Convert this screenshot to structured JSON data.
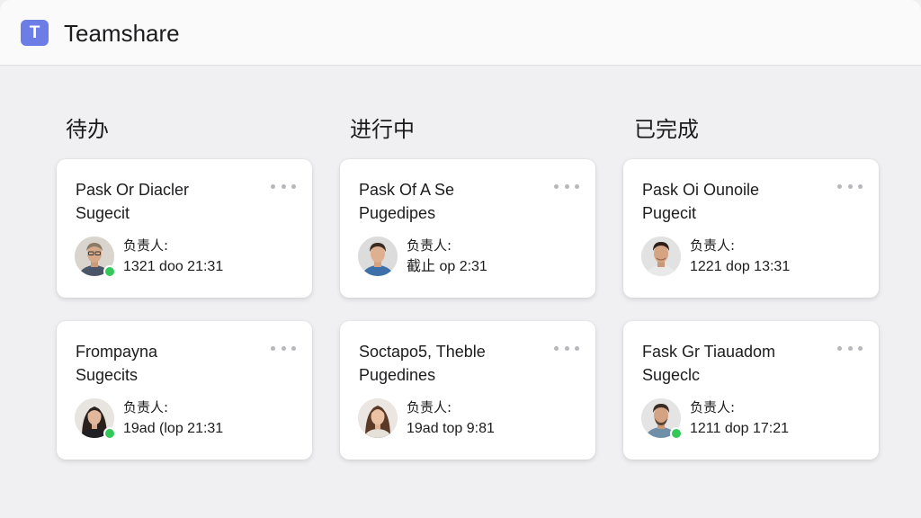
{
  "app": {
    "title": "Teamshare",
    "logo_letter": "T",
    "accent_color": "#6c7ee6"
  },
  "columns": [
    {
      "title": "待办",
      "cards": [
        {
          "title": "Pask Or Diacler\nSugecit",
          "assignee_label": "负责人:",
          "due": "1321 doo 21:31",
          "avatar": "man-glasses",
          "online": true
        },
        {
          "title": "Frompayna\nSugecits",
          "assignee_label": "负责人:",
          "due": "19ad (lop 21:31",
          "avatar": "woman-dark-hair",
          "online": true
        }
      ]
    },
    {
      "title": "进行中",
      "cards": [
        {
          "title": "Pask Of A Se\nPugedipes",
          "assignee_label": "负责人:",
          "due": "截止 op 2:31",
          "avatar": "man-short-hair",
          "online": false
        },
        {
          "title": "Soctapo5, Theble\nPugedines",
          "assignee_label": "负责人:",
          "due": "19ad top 9:81",
          "avatar": "woman-brown-hair",
          "online": false
        }
      ]
    },
    {
      "title": "已完成",
      "cards": [
        {
          "title": "Pask Oi Ou​noile\nPugecit",
          "assignee_label": "负责人:",
          "due": "1221 dop 13:31",
          "avatar": "man-smiling",
          "online": false
        },
        {
          "title": "Fask Gr Tiauadom\nSugeclc",
          "assignee_label": "负责人:",
          "due": "1211 dop 17:21",
          "avatar": "man-beard",
          "online": true
        }
      ]
    }
  ],
  "colors": {
    "background": "#f0f0f2",
    "card": "#ffffff",
    "online": "#34c759",
    "more_dots": "#b7b7bc"
  }
}
